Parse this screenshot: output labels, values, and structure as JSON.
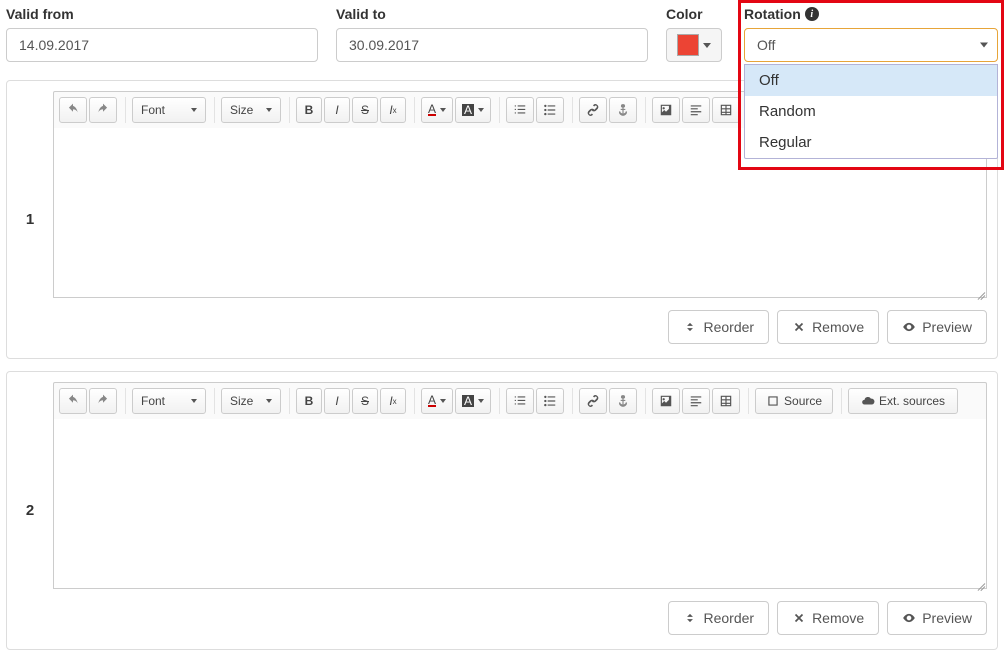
{
  "fields": {
    "valid_from": {
      "label": "Valid from",
      "value": "14.09.2017"
    },
    "valid_to": {
      "label": "Valid to",
      "value": "30.09.2017"
    },
    "color": {
      "label": "Color",
      "value_hex": "#ec4434"
    },
    "rotation": {
      "label": "Rotation",
      "value": "Off",
      "options": [
        "Off",
        "Random",
        "Regular"
      ]
    }
  },
  "toolbar": {
    "font_label": "Font",
    "size_label": "Size",
    "source_label": "Source",
    "ext_sources_label": "Ext. sources"
  },
  "blocks": [
    {
      "number": "1"
    },
    {
      "number": "2"
    }
  ],
  "actions": {
    "reorder": "Reorder",
    "remove": "Remove",
    "preview": "Preview"
  }
}
